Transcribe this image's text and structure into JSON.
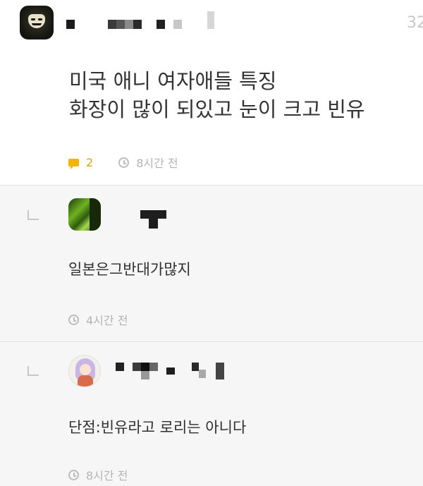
{
  "post": {
    "title_lines": [
      "미국 애니 여자애들 특징",
      "화장이 많이 되있고 눈이 크고 빈유"
    ],
    "comment_count": "2",
    "time": "8시간 전",
    "corner_count": "32"
  },
  "replies": [
    {
      "text": "일본은그반대가많지",
      "time": "4시간 전"
    },
    {
      "text": "단점:빈유라고 로리는 아니다",
      "time": "8시간 전"
    }
  ],
  "colors": {
    "accent": "#f4b400",
    "reply_background": "#f6f6f6",
    "meta_text": "#b4b4b4"
  },
  "icons": [
    "comment-icon",
    "clock-icon",
    "reply-arrow-icon"
  ]
}
